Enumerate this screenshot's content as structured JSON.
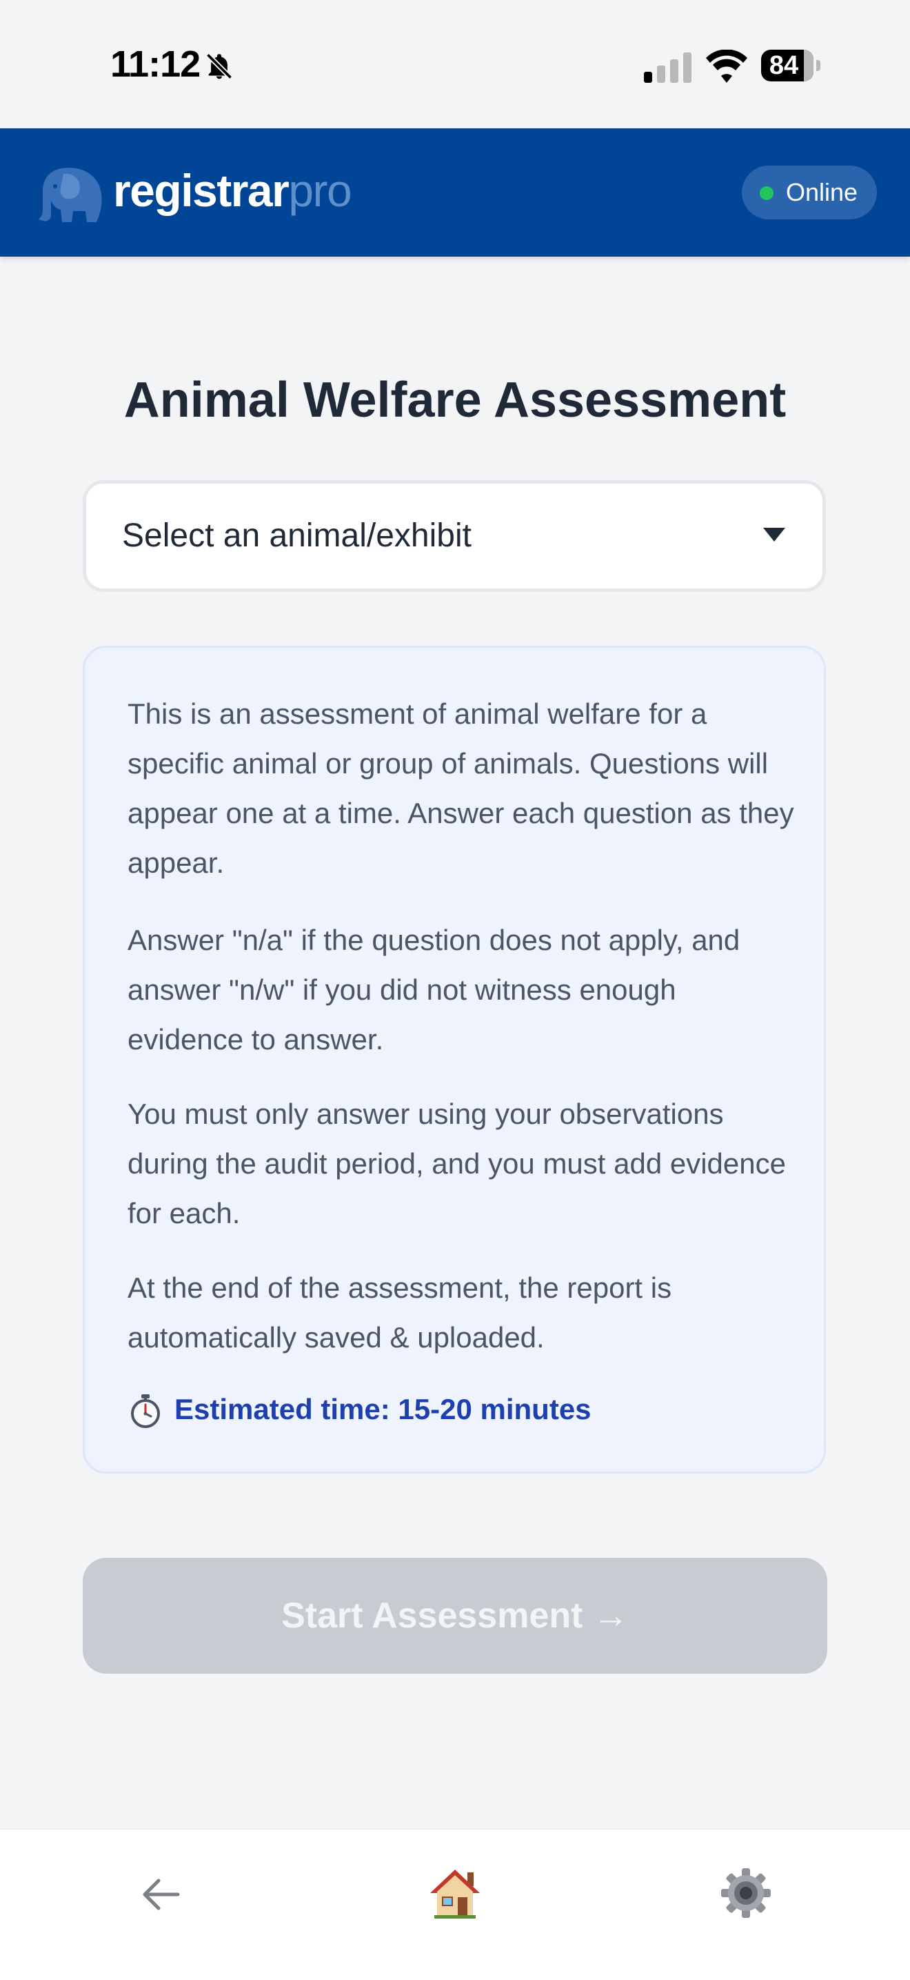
{
  "status_bar": {
    "time": "11:12",
    "battery": "84",
    "icons": [
      "bell-off-icon",
      "signal-icon",
      "wifi-icon",
      "battery-icon"
    ]
  },
  "header": {
    "brand_main": "registrar",
    "brand_accent": "pro",
    "logo_icon": "elephant-icon",
    "status": "Online",
    "status_color": "#22c55e",
    "background": "#004596"
  },
  "main": {
    "title": "Animal Welfare Assessment",
    "select": {
      "placeholder": "Select an animal/exhibit",
      "icon": "chevron-down-icon"
    },
    "info": {
      "paragraphs": [
        "This is an assessment of animal welfare for a specific animal or group of animals. Questions will appear one at a time. Answer each question as they appear.",
        "Answer \"n/a\" if the question does not apply, and answer \"n/w\" if you did not witness enough evidence to answer.",
        "You must only answer using your observations during the audit period, and you must add evidence for each.",
        "At the end of the assessment, the report is automatically saved & uploaded."
      ],
      "estimate_icon": "stopwatch-icon",
      "estimate": "Estimated time: 15-20 minutes",
      "estimate_color": "#1e40af"
    },
    "start_button": {
      "label": "Start Assessment →",
      "disabled": true
    }
  },
  "bottom_nav": {
    "items": [
      {
        "name": "back",
        "icon": "arrow-left-icon"
      },
      {
        "name": "home",
        "icon": "house-icon"
      },
      {
        "name": "settings",
        "icon": "gear-icon"
      }
    ]
  }
}
